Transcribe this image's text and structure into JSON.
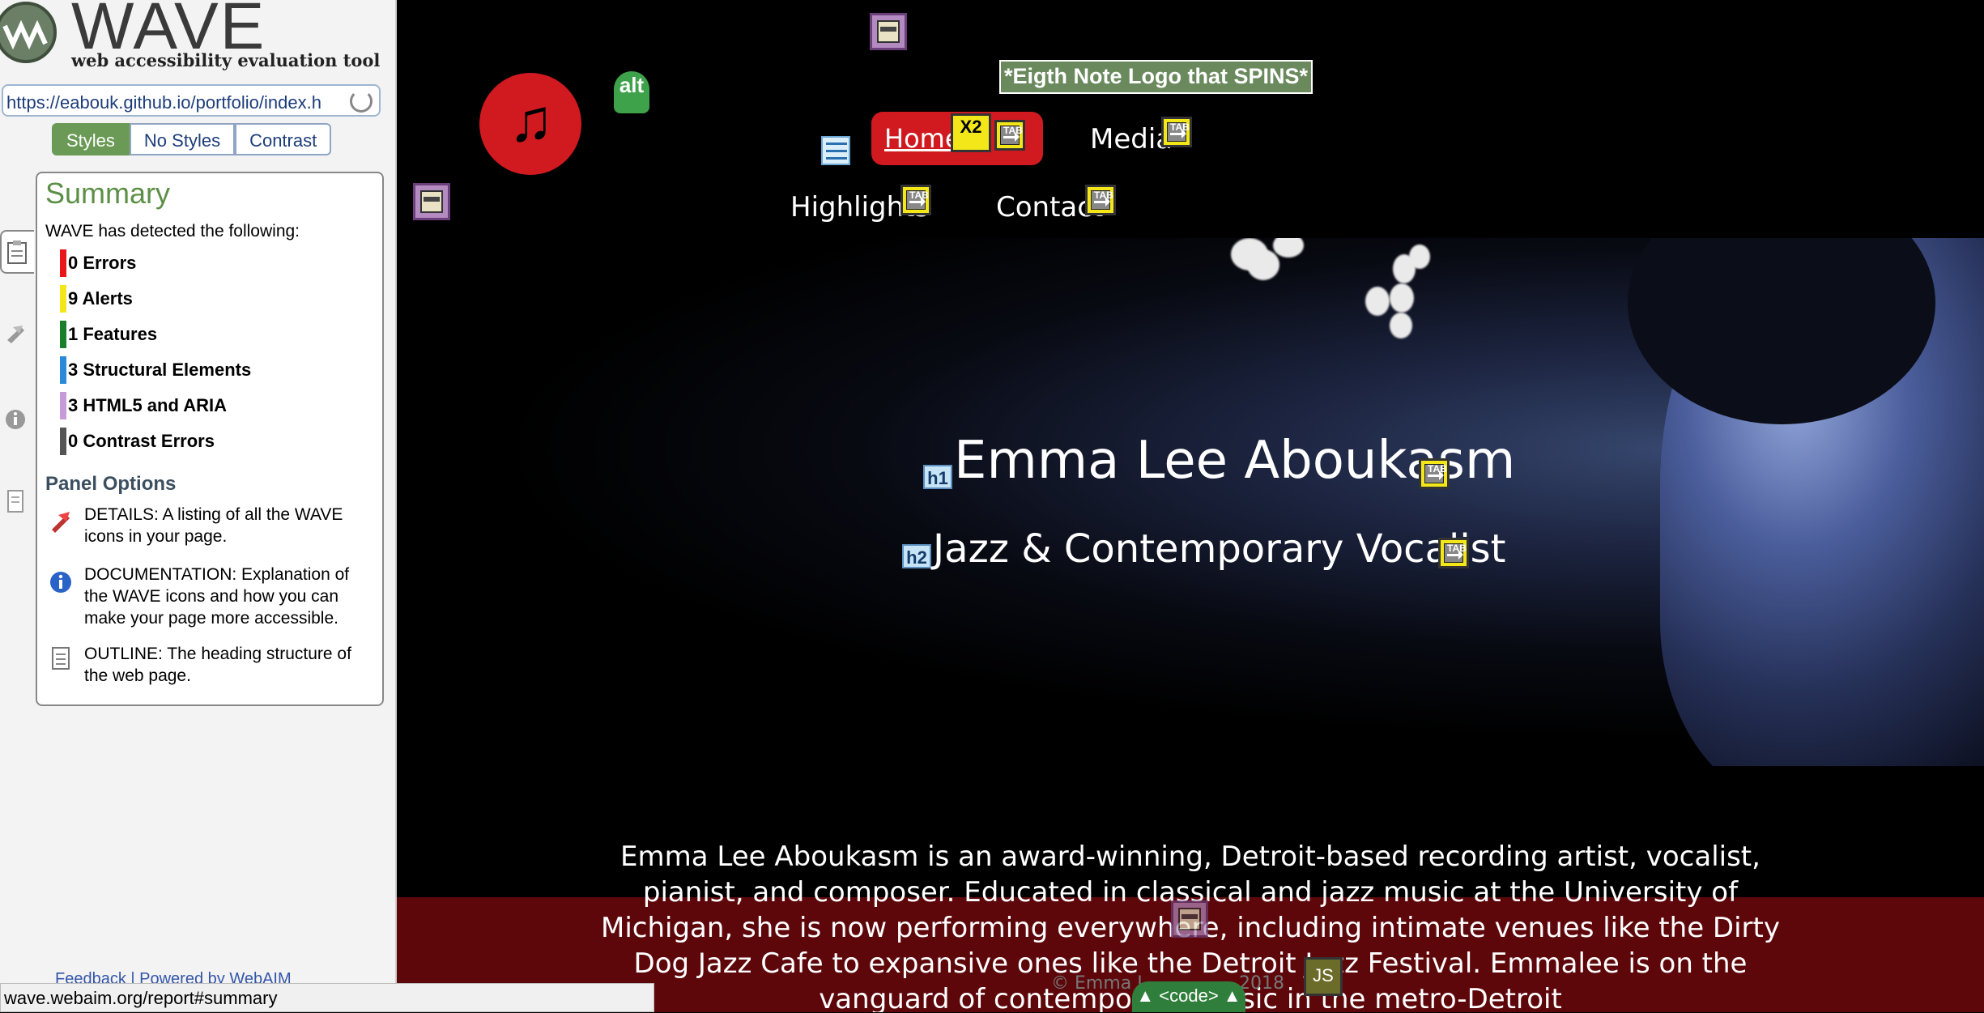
{
  "wave": {
    "logo_word": "WAVE",
    "tagline": "web accessibility evaluation tool",
    "url": "https://eabouk.github.io/portfolio/index.h",
    "tabs": [
      "Styles",
      "No Styles",
      "Contrast"
    ],
    "summary": {
      "title": "Summary",
      "subtitle": "WAVE has detected the following:",
      "stats": [
        {
          "label": "0 Errors",
          "color": "#e8151b"
        },
        {
          "label": "9 Alerts",
          "color": "#f3e71a"
        },
        {
          "label": "1 Features",
          "color": "#1a7f2b"
        },
        {
          "label": "3 Structural Elements",
          "color": "#2b8ad8"
        },
        {
          "label": "3 HTML5 and ARIA",
          "color": "#c79bd6"
        },
        {
          "label": "0 Contrast Errors",
          "color": "#555555"
        }
      ],
      "options_title": "Panel Options",
      "options": [
        {
          "text": "DETAILS: A listing of all the WAVE icons in your page.",
          "icon": "flag-icon"
        },
        {
          "text": "DOCUMENTATION: Explanation of the WAVE icons and how you can make your page more accessible.",
          "icon": "info-icon"
        },
        {
          "text": "OUTLINE: The heading structure of the web page.",
          "icon": "document-icon"
        }
      ]
    },
    "status_url": "wave.webaim.org/report#summary",
    "footer_link": "Feedback | Powered by WebAIM"
  },
  "site": {
    "logo_note": "♫",
    "alt_badge": "alt",
    "eighth_note_label": "*Eigth Note Logo that SPINS*",
    "nav": {
      "home": "Home",
      "media": "Media",
      "highlights": "Highlights",
      "contact": "Contact",
      "x2": "X2"
    },
    "hero": {
      "h1_tag": "h1",
      "title": "Emma Lee Aboukasm",
      "h2_tag": "h2",
      "subtitle": "Jazz & Contemporary Vocalist"
    },
    "bio": "Emma Lee Aboukasm is an award-winning, Detroit-based recording artist, vocalist, pianist, and composer. Educated in classical and jazz music at the University of Michigan, she is now performing everywhere, including intimate venues like the Dirty Dog Jazz Cafe to expansive ones like the Detroit Jazz Festival. Emmalee is on the vanguard of contemporary music in the metro-Detroit",
    "footer_partial": "© Emma L",
    "footer_year": "2018",
    "code_tab": "▲ <code> ▲",
    "js_badge": "JS"
  }
}
